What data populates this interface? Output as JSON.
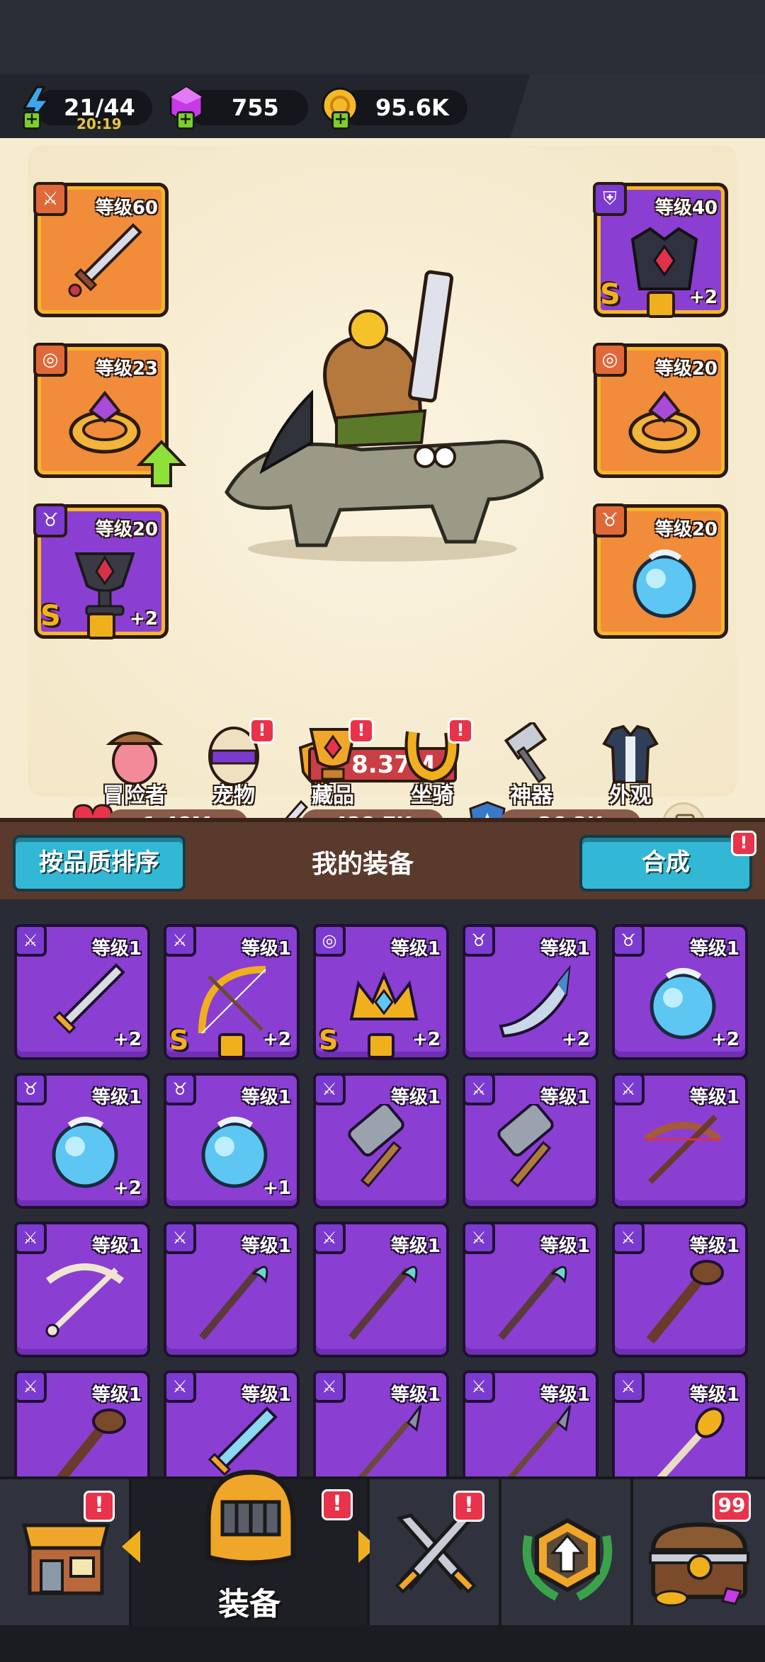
{
  "resources": {
    "energy": {
      "value": "21/44",
      "timer": "20:19",
      "icon": "lightning-icon"
    },
    "gems": {
      "value": "755",
      "icon": "gem-icon"
    },
    "coins": {
      "value": "95.6K",
      "icon": "coin-icon"
    }
  },
  "equipped": {
    "left": [
      {
        "level": "等级60",
        "type": "sword",
        "color": "orange"
      },
      {
        "level": "等级23",
        "type": "ring",
        "color": "orange"
      },
      {
        "level": "等级20",
        "type": "chalice",
        "color": "purple",
        "rank": "S",
        "bonus": "+2"
      }
    ],
    "right": [
      {
        "level": "等级40",
        "type": "armor",
        "color": "purple",
        "rank": "S",
        "bonus": "+2"
      },
      {
        "level": "等级20",
        "type": "ring",
        "color": "orange"
      },
      {
        "level": "等级20",
        "type": "orb",
        "color": "orange"
      }
    ]
  },
  "power": "8.37M",
  "stats": {
    "hp": "1.48M",
    "attack": "428.7K",
    "defense": "36.3K"
  },
  "menu": [
    {
      "label": "冒险者",
      "badge": ""
    },
    {
      "label": "宠物",
      "badge": "!"
    },
    {
      "label": "藏品",
      "badge": "!"
    },
    {
      "label": "坐骑",
      "badge": "!"
    },
    {
      "label": "神器",
      "badge": ""
    },
    {
      "label": "外观",
      "badge": ""
    }
  ],
  "inventory_header": {
    "sort_label": "按品质排序",
    "title": "我的装备",
    "merge_label": "合成",
    "merge_badge": "!"
  },
  "inventory": [
    {
      "level": "等级1",
      "type": "sword",
      "bonus": "+2",
      "rank": ""
    },
    {
      "level": "等级1",
      "type": "bow",
      "bonus": "+2",
      "rank": "S"
    },
    {
      "level": "等级1",
      "type": "crown",
      "bonus": "+2",
      "rank": "S"
    },
    {
      "level": "等级1",
      "type": "horn",
      "bonus": "+2",
      "rank": ""
    },
    {
      "level": "等级1",
      "type": "orb",
      "bonus": "+2",
      "rank": ""
    },
    {
      "level": "等级1",
      "type": "orb",
      "bonus": "+2",
      "rank": ""
    },
    {
      "level": "等级1",
      "type": "orb",
      "bonus": "+1",
      "rank": ""
    },
    {
      "level": "等级1",
      "type": "hammer",
      "bonus": "",
      "rank": ""
    },
    {
      "level": "等级1",
      "type": "hammer",
      "bonus": "",
      "rank": ""
    },
    {
      "level": "等级1",
      "type": "crossbow",
      "bonus": "",
      "rank": ""
    },
    {
      "level": "等级1",
      "type": "bonebow",
      "bonus": "",
      "rank": ""
    },
    {
      "level": "等级1",
      "type": "staff",
      "bonus": "",
      "rank": ""
    },
    {
      "level": "等级1",
      "type": "staff",
      "bonus": "",
      "rank": ""
    },
    {
      "level": "等级1",
      "type": "staff",
      "bonus": "",
      "rank": ""
    },
    {
      "level": "等级1",
      "type": "club",
      "bonus": "",
      "rank": ""
    },
    {
      "level": "等级1",
      "type": "club",
      "bonus": "",
      "rank": ""
    },
    {
      "level": "等级1",
      "type": "icesword",
      "bonus": "",
      "rank": ""
    },
    {
      "level": "等级1",
      "type": "spear",
      "bonus": "",
      "rank": ""
    },
    {
      "level": "等级1",
      "type": "spear",
      "bonus": "",
      "rank": ""
    },
    {
      "level": "等级1",
      "type": "torch",
      "bonus": "",
      "rank": ""
    }
  ],
  "nav": {
    "shop_badge": "!",
    "equip_label": "装备",
    "equip_badge": "!",
    "battle_badge": "!",
    "chest_count": "99"
  },
  "colors": {
    "orange_slot": "#f08c3a",
    "purple_slot": "#8a3fd2",
    "gold_border": "#f5b62a",
    "accent_blue": "#32b8d4",
    "badge_red": "#e8334a"
  }
}
